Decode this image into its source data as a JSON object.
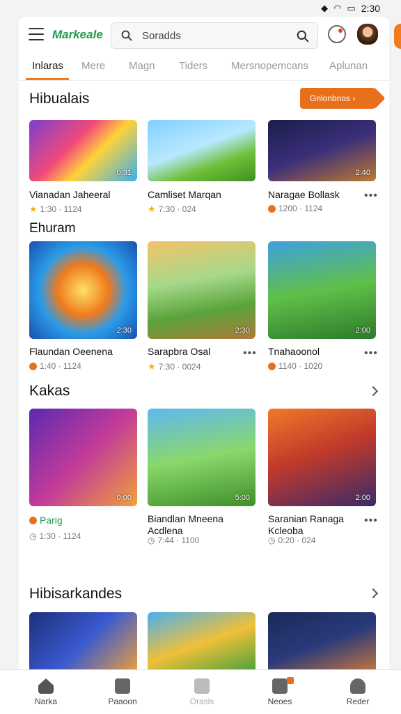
{
  "status": {
    "time": "2:30",
    "wifi_icon": "wifi-icon",
    "battery_icon": "battery-icon"
  },
  "header": {
    "logo": "Markeale",
    "search_placeholder": "Soradds"
  },
  "tabs": [
    "Inlaras",
    "Mere",
    "Magn",
    "Tiders",
    "Mersnopemcans",
    "Aplunan"
  ],
  "sections": [
    {
      "title": "Hibualais",
      "button": "Gnlonbnos ›"
    },
    {
      "title": "Ehuram"
    },
    {
      "title": "Kakas"
    },
    {
      "title": "Hibisarkandes"
    }
  ],
  "row1": [
    {
      "dur": "0:31",
      "name": "Vianadan Jaheeral",
      "meta": "1:30 · 1124",
      "icon": "star"
    },
    {
      "name": "Camliset Marqan",
      "meta": "7:30 · 024",
      "icon": "star"
    },
    {
      "dur": "2:40",
      "name": "Naragae Bollask",
      "meta": "1200 · 1124",
      "icon": "orange-dot"
    }
  ],
  "row2": [
    {
      "dur": "2:30",
      "name": "Flaundan Oeenena",
      "meta": "1:40 · 1124",
      "icon": "orange-dot"
    },
    {
      "dur": "2:30",
      "name": "Sarapbra Osal",
      "meta": "7:30 · 0024",
      "icon": "star"
    },
    {
      "dur": "2:00",
      "name": "Tnahaoonol",
      "meta": "1140 · 1020",
      "icon": "orange-dot"
    }
  ],
  "row3": [
    {
      "dur": "0:00",
      "name": "Parig",
      "meta": "1:30 · 1124"
    },
    {
      "dur": "5:00",
      "name": "Biandlan Mneena Acdlena",
      "meta": "7:44 · 1100"
    },
    {
      "dur": "2:00",
      "name": "Saranian Ranaga Kcleoba",
      "meta": "0:20 · 024"
    }
  ],
  "nav": [
    {
      "label": "Narka",
      "icon": "home-icon"
    },
    {
      "label": "Paaoon",
      "icon": "bag-icon"
    },
    {
      "label": "Orasis",
      "icon": "bag-icon"
    },
    {
      "label": "Neoes",
      "icon": "chart-icon"
    },
    {
      "label": "Reder",
      "icon": "person-icon"
    }
  ],
  "colors": {
    "accent": "#f07a1e",
    "green": "#1e9b4a"
  }
}
